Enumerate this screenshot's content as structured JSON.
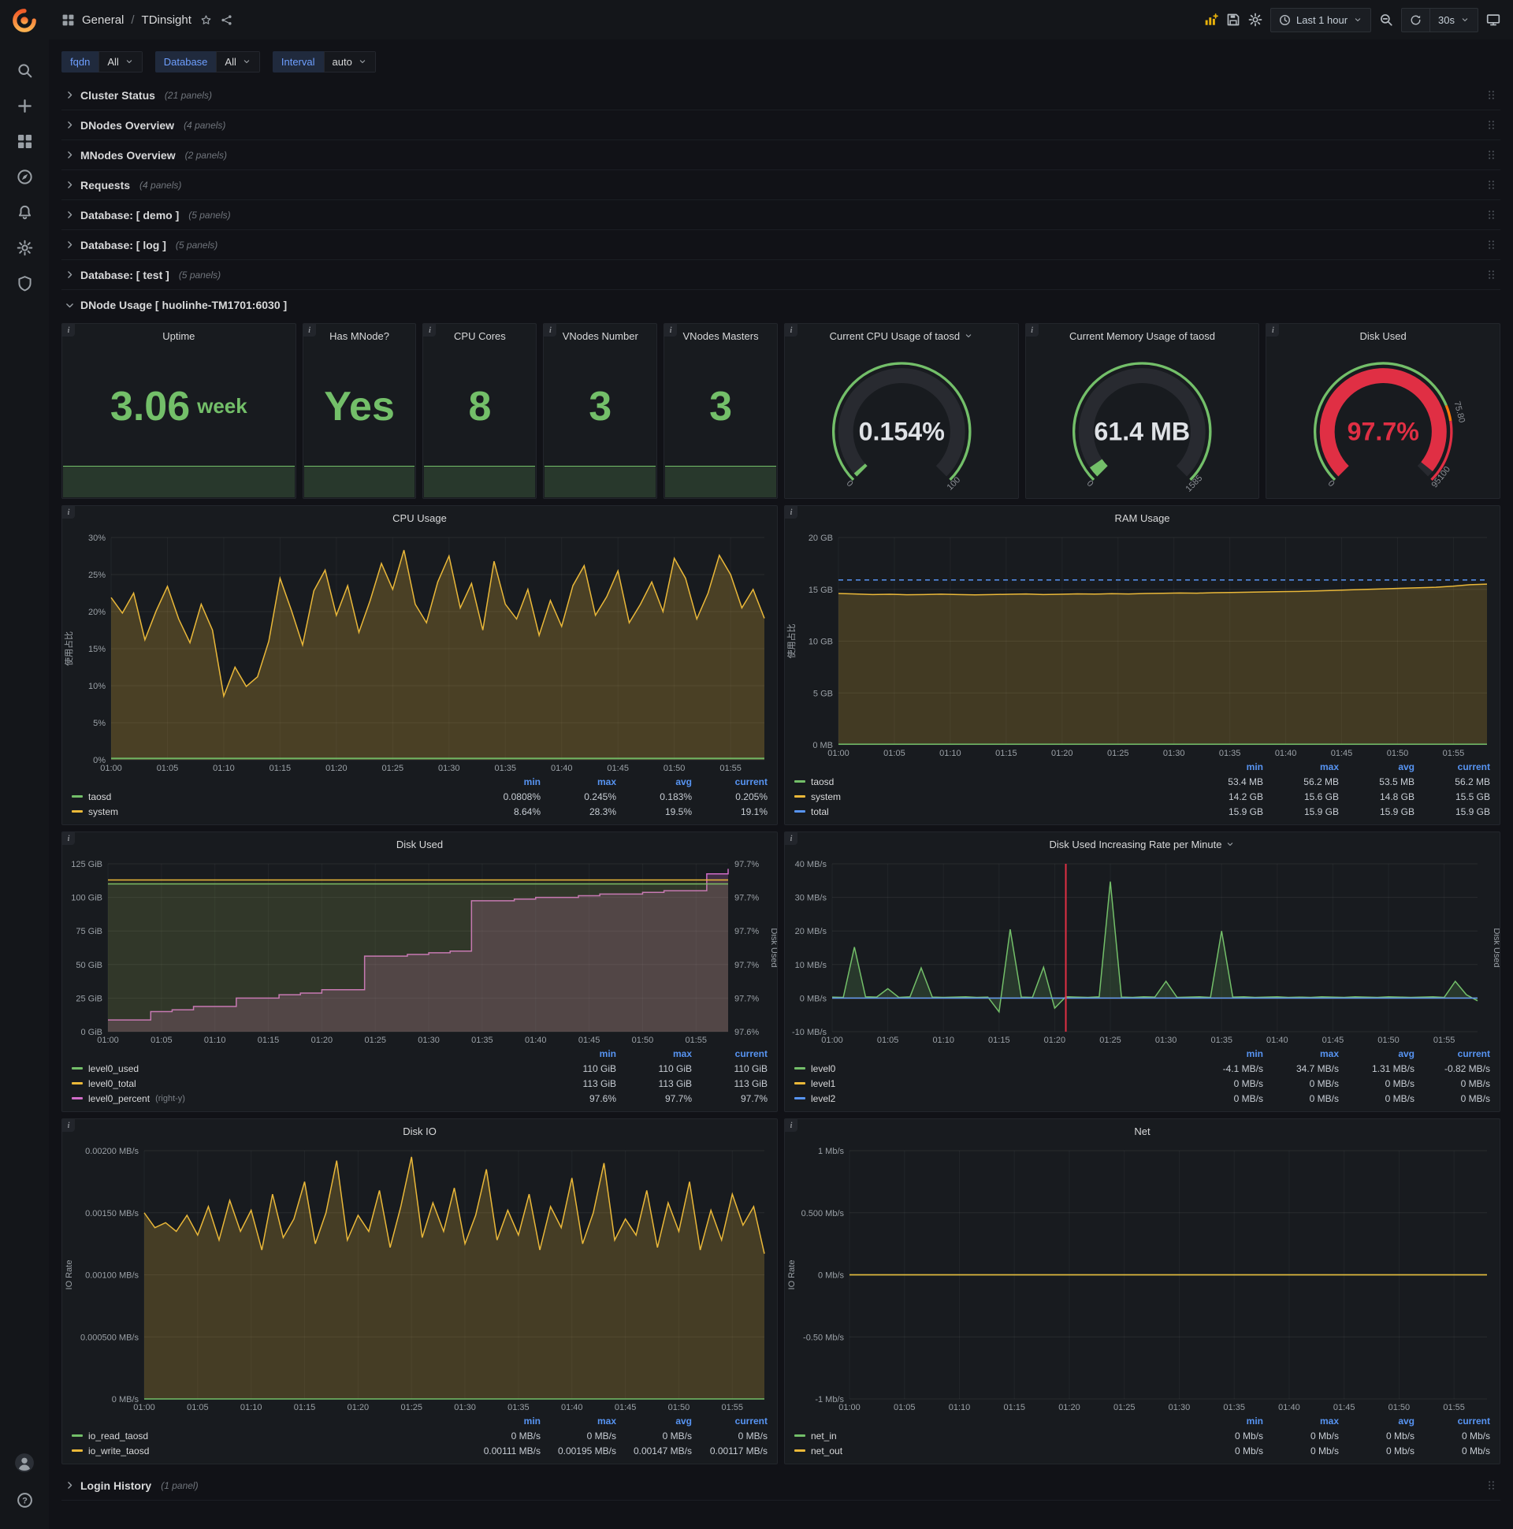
{
  "colors": {
    "green": "#73bf69",
    "yellow": "#eab839",
    "blue": "#5794f2",
    "pink": "#d06cc8",
    "red": "#e02f44",
    "orange": "#f46800"
  },
  "topnav": {
    "breadcrumb": {
      "section": "General",
      "separator": "/",
      "page": "TDinsight"
    },
    "time_range": "Last 1 hour",
    "refresh_interval": "30s"
  },
  "sidebar": {
    "top_icons": [
      "search-icon",
      "plus-icon",
      "dashboards-icon",
      "explore-icon",
      "alerting-icon",
      "settings-icon",
      "shield-icon"
    ],
    "bottom_icons": [
      "avatar-icon",
      "help-icon"
    ]
  },
  "variables": [
    {
      "label": "fqdn",
      "value": "All"
    },
    {
      "label": "Database",
      "value": "All"
    },
    {
      "label": "Interval",
      "value": "auto"
    }
  ],
  "collapsed_rows": [
    {
      "title": "Cluster Status",
      "count": "(21 panels)"
    },
    {
      "title": "DNodes Overview",
      "count": "(4 panels)"
    },
    {
      "title": "MNodes Overview",
      "count": "(2 panels)"
    },
    {
      "title": "Requests",
      "count": "(4 panels)"
    },
    {
      "title": "Database: [ demo ]",
      "count": "(5 panels)"
    },
    {
      "title": "Database: [ log ]",
      "count": "(5 panels)"
    },
    {
      "title": "Database: [ test ]",
      "count": "(5 panels)"
    }
  ],
  "expanded_row": {
    "title": "DNode Usage [ huolinhe-TM1701:6030 ]"
  },
  "footer_row": {
    "title": "Login History",
    "count": "(1 panel)"
  },
  "stat_panels": [
    {
      "title": "Uptime",
      "value": "3.06",
      "unit": "week"
    },
    {
      "title": "Has MNode?",
      "value": "Yes",
      "unit": ""
    },
    {
      "title": "CPU Cores",
      "value": "8",
      "unit": ""
    },
    {
      "title": "VNodes Number",
      "value": "3",
      "unit": ""
    },
    {
      "title": "VNodes Masters",
      "value": "3",
      "unit": ""
    }
  ],
  "gauge_panels": [
    {
      "title": "Current CPU Usage of taosd",
      "has_caret": true,
      "value": "0.154%",
      "fraction": 0.00154,
      "value_color": "#dfe2e6",
      "arc_color": "#73bf69",
      "labels": [
        {
          "text": "0",
          "frac": 0
        },
        {
          "text": "100",
          "frac": 1
        }
      ],
      "thresholds": [
        {
          "color": "#73bf69",
          "to": 1
        }
      ]
    },
    {
      "title": "Current Memory Usage of taosd",
      "has_caret": false,
      "value": "61.4 MB",
      "fraction": 0.0387,
      "value_color": "#dfe2e6",
      "arc_color": "#73bf69",
      "labels": [
        {
          "text": "0",
          "frac": 0
        },
        {
          "text": "1585",
          "frac": 1
        }
      ],
      "thresholds": [
        {
          "color": "#73bf69",
          "to": 1
        }
      ]
    },
    {
      "title": "Disk Used",
      "has_caret": false,
      "value": "97.7%",
      "fraction": 0.977,
      "value_color": "#e02f44",
      "arc_color": "#e02f44",
      "labels": [
        {
          "text": "0",
          "frac": 0
        },
        {
          "text": "75.80",
          "frac": 0.78
        },
        {
          "text": "95100",
          "frac": 0.975
        }
      ],
      "thresholds": [
        {
          "color": "#73bf69",
          "to": 0.75
        },
        {
          "color": "#ff780a",
          "to": 0.8
        },
        {
          "color": "#e02f44",
          "to": 1
        }
      ]
    }
  ],
  "time_axis": {
    "labels": [
      "01:00",
      "01:05",
      "01:10",
      "01:15",
      "01:20",
      "01:25",
      "01:30",
      "01:35",
      "01:40",
      "01:45",
      "01:50",
      "01:55"
    ],
    "total_minutes": 58
  },
  "charts": [
    {
      "id": "cpu",
      "title": "CPU Usage",
      "type": "line",
      "ylabel": "使用占比",
      "y_min": 0,
      "y_max": 30,
      "yticks": [
        {
          "v": 0,
          "label": "0%"
        },
        {
          "v": 5,
          "label": "5%"
        },
        {
          "v": 10,
          "label": "10%"
        },
        {
          "v": 15,
          "label": "15%"
        },
        {
          "v": 20,
          "label": "20%"
        },
        {
          "v": 25,
          "label": "25%"
        },
        {
          "v": 30,
          "label": "30%"
        }
      ],
      "series": [
        {
          "name": "system",
          "color": "#eab839",
          "fill": 0.24,
          "values": [
            21.9,
            19.8,
            22.5,
            16.2,
            20.1,
            23.4,
            19.0,
            15.8,
            21.0,
            17.5,
            8.6,
            12.5,
            9.9,
            11.2,
            16.0,
            24.5,
            20.2,
            15.5,
            22.8,
            25.6,
            19.5,
            23.5,
            17.2,
            21.5,
            26.5,
            23.0,
            28.3,
            21.0,
            18.5,
            24.0,
            27.5,
            20.5,
            23.8,
            17.5,
            26.8,
            21.0,
            19.0,
            23.0,
            16.8,
            21.5,
            18.0,
            23.5,
            26.2,
            19.5,
            22.0,
            25.5,
            18.5,
            21.0,
            24.0,
            20.0,
            27.2,
            24.5,
            19.0,
            22.5,
            27.6,
            25.0,
            20.5,
            23.0,
            19.1
          ]
        },
        {
          "name": "taosd",
          "color": "#73bf69",
          "fill": 0.3,
          "values": [
            0.2,
            0.2
          ]
        }
      ],
      "legend": {
        "columns": [
          "min",
          "max",
          "avg",
          "current"
        ],
        "rows": [
          {
            "name": "taosd",
            "color": "#73bf69",
            "values": [
              "0.0808%",
              "0.245%",
              "0.183%",
              "0.205%"
            ]
          },
          {
            "name": "system",
            "color": "#eab839",
            "values": [
              "8.64%",
              "28.3%",
              "19.5%",
              "19.1%"
            ]
          }
        ]
      }
    },
    {
      "id": "ram",
      "title": "RAM Usage",
      "type": "line",
      "ylabel": "使用占比",
      "y_min": 0,
      "y_max": 20,
      "yticks": [
        {
          "v": 0,
          "label": "0 MB"
        },
        {
          "v": 5,
          "label": "5 GB"
        },
        {
          "v": 10,
          "label": "10 GB"
        },
        {
          "v": 15,
          "label": "15 GB"
        },
        {
          "v": 20,
          "label": "20 GB"
        }
      ],
      "series": [
        {
          "name": "system",
          "color": "#eab839",
          "fill": 0.2,
          "values": [
            14.6,
            14.55,
            14.5,
            14.52,
            14.48,
            14.5,
            14.53,
            14.5,
            14.47,
            14.5,
            14.52,
            14.55,
            14.5,
            14.52,
            14.56,
            14.54,
            14.58,
            14.55,
            14.6,
            14.62,
            14.65,
            14.63,
            14.68,
            14.7,
            14.72,
            14.75,
            14.78,
            14.8,
            14.85,
            14.9,
            14.95,
            15.0,
            15.05,
            15.1,
            15.15,
            15.2,
            15.3,
            15.45,
            15.5
          ]
        },
        {
          "name": "total",
          "color": "#5794f2",
          "fill": 0,
          "dash": "6,5",
          "values": [
            15.9,
            15.9
          ]
        },
        {
          "name": "taosd",
          "color": "#73bf69",
          "fill": 0.4,
          "values": [
            0.054,
            0.054
          ]
        }
      ],
      "legend": {
        "columns": [
          "min",
          "max",
          "avg",
          "current"
        ],
        "rows": [
          {
            "name": "taosd",
            "color": "#73bf69",
            "values": [
              "53.4 MB",
              "56.2 MB",
              "53.5 MB",
              "56.2 MB"
            ]
          },
          {
            "name": "system",
            "color": "#eab839",
            "values": [
              "14.2 GB",
              "15.6 GB",
              "14.8 GB",
              "15.5 GB"
            ]
          },
          {
            "name": "total",
            "color": "#5794f2",
            "values": [
              "15.9 GB",
              "15.9 GB",
              "15.9 GB",
              "15.9 GB"
            ]
          }
        ]
      }
    },
    {
      "id": "disk",
      "title": "Disk Used",
      "type": "line",
      "ylabel": "",
      "y_min": 0,
      "y_max": 125,
      "yticks": [
        {
          "v": 0,
          "label": "0 GiB"
        },
        {
          "v": 25,
          "label": "25 GiB"
        },
        {
          "v": 50,
          "label": "50 GiB"
        },
        {
          "v": 75,
          "label": "75 GiB"
        },
        {
          "v": 100,
          "label": "100 GiB"
        },
        {
          "v": 125,
          "label": "125 GiB"
        }
      ],
      "y2": {
        "min": 97.6,
        "max": 97.7,
        "label": "Disk Used",
        "ticks": [
          {
            "v": 97.7,
            "label": "97.7%"
          },
          {
            "v": 97.68,
            "label": "97.7%"
          },
          {
            "v": 97.66,
            "label": "97.7%"
          },
          {
            "v": 97.64,
            "label": "97.7%"
          },
          {
            "v": 97.62,
            "label": "97.7%"
          },
          {
            "v": 97.6,
            "label": "97.6%"
          }
        ]
      },
      "series": [
        {
          "name": "level0_percent",
          "color": "#d06cc8",
          "axis": "right",
          "step": true,
          "fill": 0.22,
          "values": [
            97.607,
            97.607,
            97.612,
            97.613,
            97.615,
            97.615,
            97.62,
            97.62,
            97.622,
            97.623,
            97.625,
            97.625,
            97.645,
            97.645,
            97.646,
            97.647,
            97.648,
            97.678,
            97.678,
            97.679,
            97.68,
            97.68,
            97.681,
            97.682,
            97.682,
            97.683,
            97.684,
            97.684,
            97.694,
            97.697
          ]
        },
        {
          "name": "level0_used",
          "color": "#73bf69",
          "fill": 0.12,
          "values": [
            110,
            110
          ]
        },
        {
          "name": "level0_total",
          "color": "#eab839",
          "fill": 0.07,
          "values": [
            113,
            113
          ]
        }
      ],
      "legend": {
        "columns": [
          "min",
          "max",
          "current"
        ],
        "rows": [
          {
            "name": "level0_used",
            "color": "#73bf69",
            "values": [
              "110 GiB",
              "110 GiB",
              "110 GiB"
            ]
          },
          {
            "name": "level0_total",
            "color": "#eab839",
            "values": [
              "113 GiB",
              "113 GiB",
              "113 GiB"
            ]
          },
          {
            "name": "level0_percent",
            "suffix": "(right-y)",
            "color": "#d06cc8",
            "values": [
              "97.6%",
              "97.7%",
              "97.7%"
            ]
          }
        ]
      }
    },
    {
      "id": "diskrate",
      "title": "Disk Used Increasing Rate per Minute",
      "has_caret": true,
      "type": "line",
      "ylabel": "",
      "y_min": -10,
      "y_max": 40,
      "yticks": [
        {
          "v": -10,
          "label": "-10 MB/s"
        },
        {
          "v": 0,
          "label": "0 MB/s"
        },
        {
          "v": 10,
          "label": "10 MB/s"
        },
        {
          "v": 20,
          "label": "20 MB/s"
        },
        {
          "v": 30,
          "label": "30 MB/s"
        },
        {
          "v": 40,
          "label": "40 MB/s"
        }
      ],
      "y2": {
        "label": "Disk Used",
        "ticks": []
      },
      "annotation": {
        "minute": 21,
        "color": "#e02f44"
      },
      "series": [
        {
          "name": "level0",
          "color": "#73bf69",
          "fill": 0.18,
          "values": [
            0.3,
            0.2,
            15.2,
            0.4,
            0.3,
            2.8,
            0.2,
            0.4,
            9.0,
            0.3,
            0.2,
            0.3,
            0.4,
            0.2,
            0.3,
            -4.1,
            20.5,
            0.3,
            0.2,
            9.2,
            -3.0,
            0.4,
            0.3,
            0.2,
            0.4,
            34.7,
            0.3,
            0.2,
            0.4,
            0.3,
            5.0,
            0.2,
            0.3,
            0.4,
            0.2,
            20.0,
            0.3,
            0.4,
            0.2,
            0.3,
            0.4,
            0.2,
            0.3,
            0.2,
            0.4,
            0.3,
            0.2,
            0.4,
            0.3,
            0.2,
            0.4,
            0.3,
            0.2,
            0.3,
            0.4,
            0.2,
            5.0,
            1.0,
            -0.8
          ]
        },
        {
          "name": "level1",
          "color": "#eab839",
          "fill": 0,
          "values": [
            0,
            0
          ]
        },
        {
          "name": "level2",
          "color": "#5794f2",
          "fill": 0,
          "values": [
            0,
            0
          ]
        }
      ],
      "legend": {
        "columns": [
          "min",
          "max",
          "avg",
          "current"
        ],
        "rows": [
          {
            "name": "level0",
            "color": "#73bf69",
            "values": [
              "-4.1 MB/s",
              "34.7 MB/s",
              "1.31 MB/s",
              "-0.82 MB/s"
            ]
          },
          {
            "name": "level1",
            "color": "#eab839",
            "values": [
              "0 MB/s",
              "0 MB/s",
              "0 MB/s",
              "0 MB/s"
            ]
          },
          {
            "name": "level2",
            "color": "#5794f2",
            "values": [
              "0 MB/s",
              "0 MB/s",
              "0 MB/s",
              "0 MB/s"
            ]
          }
        ]
      }
    },
    {
      "id": "diskio",
      "title": "Disk IO",
      "type": "line",
      "ylabel": "IO Rate",
      "y_min": 0,
      "y_max": 0.002,
      "yticks": [
        {
          "v": 0,
          "label": "0 MB/s"
        },
        {
          "v": 0.0005,
          "label": "0.000500 MB/s"
        },
        {
          "v": 0.001,
          "label": "0.00100 MB/s"
        },
        {
          "v": 0.0015,
          "label": "0.00150 MB/s"
        },
        {
          "v": 0.002,
          "label": "0.00200 MB/s"
        }
      ],
      "series": [
        {
          "name": "io_write_taosd",
          "color": "#eab839",
          "fill": 0.22,
          "values": [
            0.0015,
            0.00138,
            0.00142,
            0.00135,
            0.00148,
            0.00132,
            0.00155,
            0.00128,
            0.0016,
            0.00135,
            0.00152,
            0.0012,
            0.00165,
            0.0013,
            0.00145,
            0.00175,
            0.00125,
            0.0015,
            0.00192,
            0.00128,
            0.00148,
            0.00135,
            0.00168,
            0.00122,
            0.00155,
            0.00195,
            0.0013,
            0.00158,
            0.00135,
            0.0017,
            0.00125,
            0.00148,
            0.00185,
            0.00128,
            0.00152,
            0.00132,
            0.00165,
            0.0012,
            0.00155,
            0.00138,
            0.00178,
            0.00125,
            0.0015,
            0.0019,
            0.00128,
            0.00145,
            0.00132,
            0.00168,
            0.00122,
            0.00158,
            0.00135,
            0.00175,
            0.0012,
            0.00152,
            0.00128,
            0.00165,
            0.0014,
            0.00155,
            0.00117
          ]
        },
        {
          "name": "io_read_taosd",
          "color": "#73bf69",
          "fill": 0,
          "values": [
            0,
            0
          ]
        }
      ],
      "legend": {
        "columns": [
          "min",
          "max",
          "avg",
          "current"
        ],
        "rows": [
          {
            "name": "io_read_taosd",
            "color": "#73bf69",
            "values": [
              "0 MB/s",
              "0 MB/s",
              "0 MB/s",
              "0 MB/s"
            ]
          },
          {
            "name": "io_write_taosd",
            "color": "#eab839",
            "values": [
              "0.00111 MB/s",
              "0.00195 MB/s",
              "0.00147 MB/s",
              "0.00117 MB/s"
            ]
          }
        ]
      }
    },
    {
      "id": "net",
      "title": "Net",
      "type": "line",
      "ylabel": "IO Rate",
      "y_min": -1,
      "y_max": 1,
      "yticks": [
        {
          "v": -1,
          "label": "-1 Mb/s"
        },
        {
          "v": -0.5,
          "label": "-0.50 Mb/s"
        },
        {
          "v": 0,
          "label": "0 Mb/s"
        },
        {
          "v": 0.5,
          "label": "0.500 Mb/s"
        },
        {
          "v": 1,
          "label": "1 Mb/s"
        }
      ],
      "series": [
        {
          "name": "net_in",
          "color": "#73bf69",
          "fill": 0,
          "values": [
            0,
            0
          ]
        },
        {
          "name": "net_out",
          "color": "#eab839",
          "fill": 0,
          "values": [
            0,
            0
          ]
        }
      ],
      "legend": {
        "columns": [
          "min",
          "max",
          "avg",
          "current"
        ],
        "rows": [
          {
            "name": "net_in",
            "color": "#73bf69",
            "values": [
              "0 Mb/s",
              "0 Mb/s",
              "0 Mb/s",
              "0 Mb/s"
            ]
          },
          {
            "name": "net_out",
            "color": "#eab839",
            "values": [
              "0 Mb/s",
              "0 Mb/s",
              "0 Mb/s",
              "0 Mb/s"
            ]
          }
        ]
      }
    }
  ]
}
